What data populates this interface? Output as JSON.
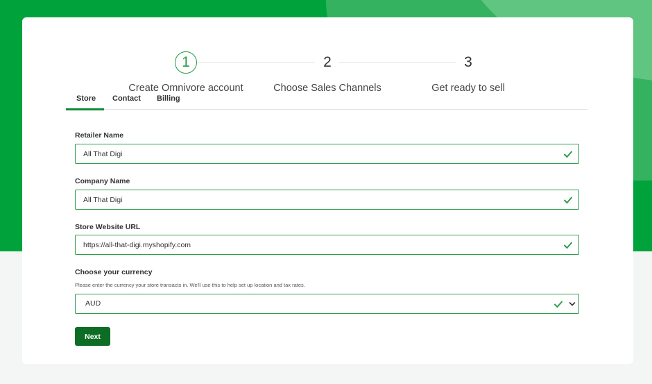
{
  "stepper": {
    "steps": [
      {
        "number": "1",
        "label": "Create Omnivore account",
        "active": true
      },
      {
        "number": "2",
        "label": "Choose Sales Channels",
        "active": false
      },
      {
        "number": "3",
        "label": "Get ready to sell",
        "active": false
      }
    ]
  },
  "tabs": [
    {
      "label": "Store",
      "active": true
    },
    {
      "label": "Contact",
      "active": false
    },
    {
      "label": "Billing",
      "active": false
    }
  ],
  "form": {
    "retailer_name": {
      "label": "Retailer Name",
      "value": "All That Digi",
      "valid": true
    },
    "company_name": {
      "label": "Company Name",
      "value": "All That Digi",
      "valid": true
    },
    "store_url": {
      "label": "Store Website URL",
      "value": "https://all-that-digi.myshopify.com",
      "valid": true
    },
    "currency": {
      "label": "Choose your currency",
      "help": "Please enter the currency your store transacts in. We'll use this to help set up location and tax rates.",
      "value": "AUD",
      "valid": true
    },
    "next_label": "Next"
  },
  "colors": {
    "brand_green": "#00a33b",
    "valid_check": "#2e9e4d",
    "button_bg": "#0e6d24"
  },
  "icons": {
    "valid": "check-icon",
    "dropdown": "chevron-down-icon"
  }
}
